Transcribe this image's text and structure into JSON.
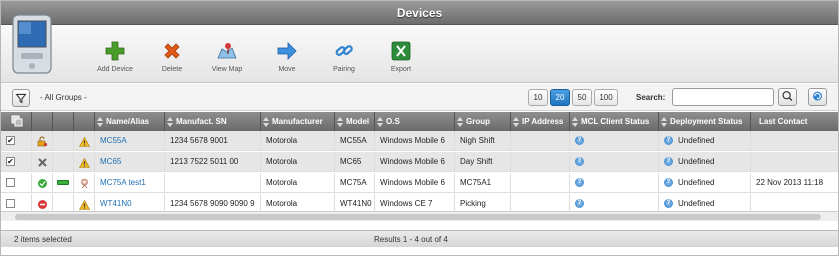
{
  "window": {
    "title": "Devices"
  },
  "toolbar": {
    "buttons": [
      {
        "label": "Add Device",
        "icon": "plus-icon",
        "color": "#4a9d2b"
      },
      {
        "label": "Delete",
        "icon": "delete-x-icon",
        "color": "#e05a1a"
      },
      {
        "label": "View Map",
        "icon": "map-icon",
        "color": "#3a8a3a"
      },
      {
        "label": "Move",
        "icon": "arrow-right-icon",
        "color": "#2f82d0"
      },
      {
        "label": "Pairing",
        "icon": "link-icon",
        "color": "#2f82d0"
      },
      {
        "label": "Export",
        "icon": "excel-icon",
        "color": "#2e8b3a"
      }
    ]
  },
  "filter": {
    "group_label": "- All Groups -",
    "page_sizes": [
      "10",
      "20",
      "50",
      "100"
    ],
    "active_page_size": "20",
    "search_label": "Search:",
    "search_value": ""
  },
  "table": {
    "columns": [
      "Name/Alias",
      "Manufact. SN",
      "Manufacturer",
      "Model",
      "O.S",
      "Group",
      "IP Address",
      "MCL Client Status",
      "Deployment Status",
      "Last Contact"
    ],
    "rows": [
      {
        "checked": true,
        "selected": true,
        "status_icon": "key-lock-icon",
        "battery": "",
        "warn": true,
        "name": "MC55A",
        "sn": "1234 5678 9001",
        "manufacturer": "Motorola",
        "model": "MC55A",
        "os": "Windows Mobile 6",
        "group": "Nigh Shift",
        "ip": "",
        "mcl_status": "?",
        "deployment": "Undefined",
        "last_contact": ""
      },
      {
        "checked": true,
        "selected": true,
        "status_icon": "tools-icon",
        "battery": "",
        "warn": true,
        "name": "MC65",
        "sn": "1213 7522 5011 00",
        "manufacturer": "Motorola",
        "model": "MC65",
        "os": "Windows Mobile 6",
        "group": "Day Shift",
        "ip": "",
        "mcl_status": "?",
        "deployment": "Undefined",
        "last_contact": ""
      },
      {
        "checked": false,
        "selected": false,
        "status_icon": "online-icon",
        "battery": "battery-full",
        "warn": false,
        "name": "MC75A test1",
        "sn": "",
        "manufacturer": "Motorola",
        "model": "MC75A",
        "os": "Windows Mobile 6",
        "group": "MC75A1",
        "ip": "",
        "mcl_status": "?",
        "deployment": "Undefined",
        "last_contact": "22 Nov 2013 11:18"
      },
      {
        "checked": false,
        "selected": false,
        "status_icon": "offline-icon",
        "battery": "",
        "warn": true,
        "name": "WT41N0",
        "sn": "1234 5678 9090 9090 9",
        "manufacturer": "Motorola",
        "model": "WT41N0",
        "os": "Windows CE 7",
        "group": "Picking",
        "ip": "",
        "mcl_status": "?",
        "deployment": "Undefined",
        "last_contact": ""
      }
    ]
  },
  "footer": {
    "selected_text": "2 items selected",
    "results_text": "Results 1 - 4 out of 4"
  }
}
